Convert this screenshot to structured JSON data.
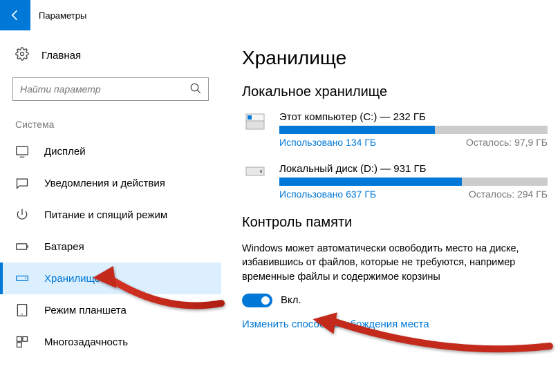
{
  "header": {
    "title": "Параметры"
  },
  "sidebar": {
    "home": "Главная",
    "search_placeholder": "Найти параметр",
    "group": "Система",
    "items": [
      {
        "label": "Дисплей"
      },
      {
        "label": "Уведомления и действия"
      },
      {
        "label": "Питание и спящий режим"
      },
      {
        "label": "Батарея"
      },
      {
        "label": "Хранилище"
      },
      {
        "label": "Режим планшета"
      },
      {
        "label": "Многозадачность"
      }
    ]
  },
  "main": {
    "title": "Хранилище",
    "local_title": "Локальное хранилище",
    "drives": [
      {
        "name": "Этот компьютер (C:) — 232 ГБ",
        "used": "Использовано 134 ГБ",
        "remain": "Осталось: 97,9 ГБ",
        "pct": 58
      },
      {
        "name": "Локальный диск (D:) — 931 ГБ",
        "used": "Использовано 637 ГБ",
        "remain": "Осталось: 294 ГБ",
        "pct": 68
      }
    ],
    "sense_title": "Контроль памяти",
    "sense_desc": "Windows может автоматически освободить место на диске, избавившись от файлов, которые не требуются, например временные файлы и содержимое корзины",
    "toggle_label": "Вкл.",
    "link": "Изменить способ освобождения места"
  }
}
